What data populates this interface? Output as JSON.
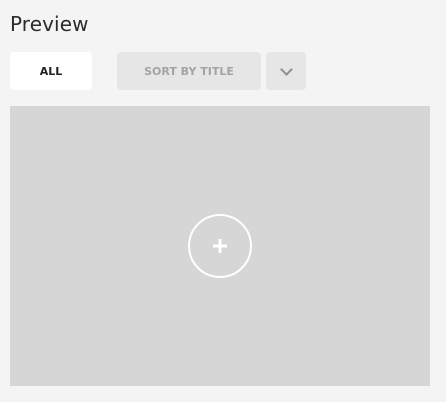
{
  "header": {
    "title": "Preview"
  },
  "filters": {
    "all_label": "ALL",
    "sort_label": "SORT BY TITLE",
    "sort_dropdown_icon": "chevron-down-icon"
  },
  "preview": {
    "add_icon": "plus-icon"
  },
  "colors": {
    "page_background": "#f4f4f4",
    "preview_background": "#d6d6d6",
    "active_button": "#ffffff",
    "inactive_button": "#e6e6e6"
  }
}
